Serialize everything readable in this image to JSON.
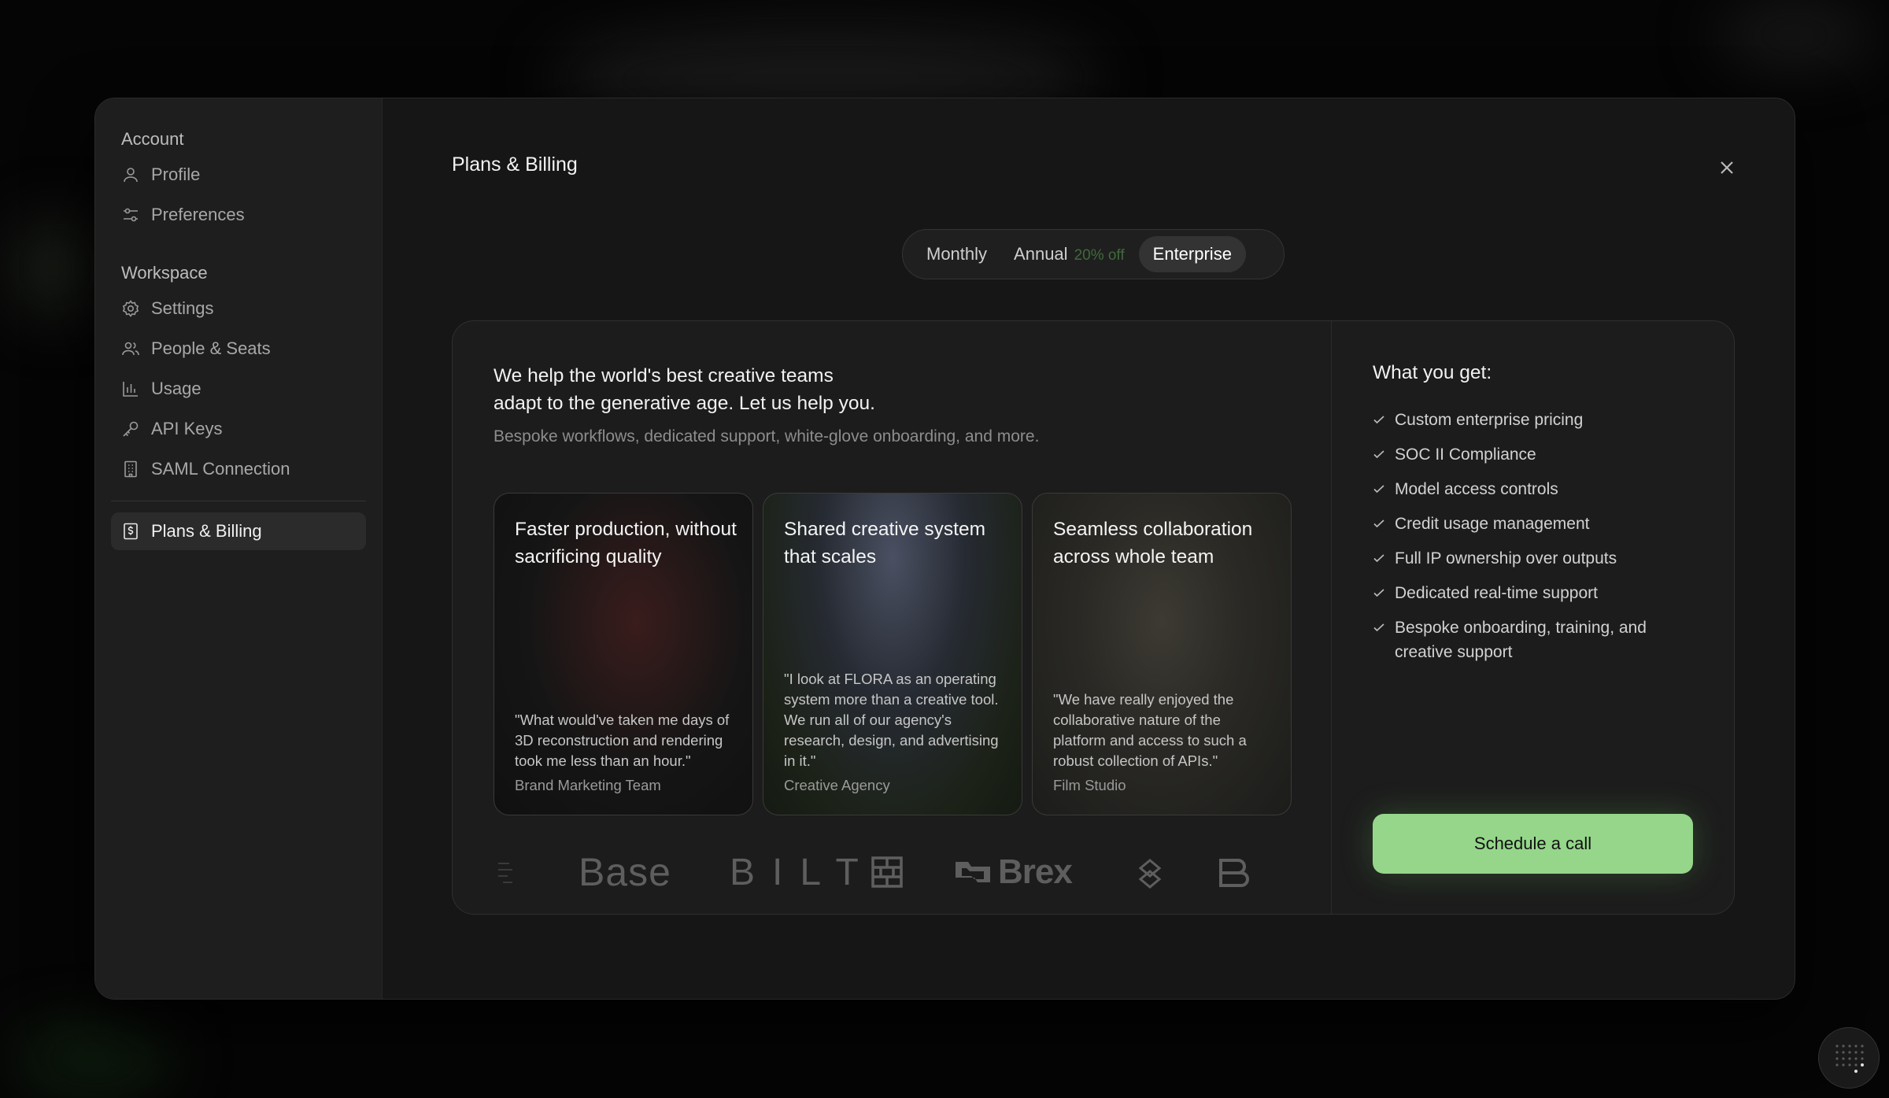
{
  "sidebar": {
    "account_label": "Account",
    "account_items": [
      {
        "label": "Profile",
        "icon": "user-icon"
      },
      {
        "label": "Preferences",
        "icon": "sliders-icon"
      }
    ],
    "workspace_label": "Workspace",
    "workspace_items": [
      {
        "label": "Settings",
        "icon": "gear-icon"
      },
      {
        "label": "People & Seats",
        "icon": "people-icon"
      },
      {
        "label": "Usage",
        "icon": "bar-chart-icon"
      },
      {
        "label": "API Keys",
        "icon": "key-icon"
      },
      {
        "label": "SAML Connection",
        "icon": "building-icon"
      }
    ],
    "active_item": {
      "label": "Plans & Billing",
      "icon": "dollar-doc-icon"
    }
  },
  "main": {
    "title": "Plans & Billing",
    "toggle": {
      "monthly": "Monthly",
      "annual": "Annual",
      "annual_discount": "20% off",
      "enterprise": "Enterprise",
      "selected": "Enterprise"
    },
    "card": {
      "headline_line1": "We help the world's best creative teams",
      "headline_line2": "adapt to the generative age. Let us help you.",
      "subline": "Bespoke workflows, dedicated support, white-glove onboarding, and more.",
      "testimonials": [
        {
          "title": "Faster production, without sacrificing quality",
          "quote": "\"What would've taken me days of 3D reconstruction and rendering took me less than an hour.\"",
          "author": "Brand Marketing Team"
        },
        {
          "title": "Shared creative system that scales",
          "quote": "\"I look at FLORA as an operating system more than a creative tool. We run all of our agency's research, design, and advertising in it.\"",
          "author": "Creative Agency"
        },
        {
          "title": "Seamless collaboration across whole team",
          "quote": "\"We have really enjoyed the collaborative nature of the platform and access to such a robust collection of APIs.\"",
          "author": "Film Studio"
        }
      ],
      "logos": [
        "Base",
        "BILT",
        "Brex"
      ],
      "features_title": "What you get:",
      "features": [
        "Custom enterprise pricing",
        "SOC II Compliance",
        "Model access controls",
        "Credit usage management",
        "Full IP ownership over outputs",
        "Dedicated real-time support",
        "Bespoke onboarding, training, and creative support"
      ],
      "cta": "Schedule a call"
    }
  },
  "colors": {
    "accent_green": "#95d68a",
    "discount_green": "#3f6b3a",
    "modal_bg": "#161616",
    "sidebar_bg": "#1e1e1e"
  }
}
